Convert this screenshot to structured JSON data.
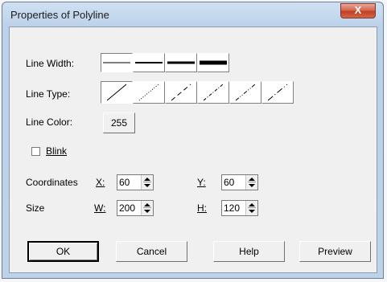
{
  "window": {
    "title": "Properties of Polyline",
    "close_glyph": "X"
  },
  "line_width": {
    "label": "Line Width:",
    "options": [
      "1",
      "2",
      "3",
      "4"
    ],
    "selected_index": 0
  },
  "line_type": {
    "label": "Line Type:",
    "options": [
      "solid",
      "dot",
      "dash",
      "dash-dot",
      "dash-dot-dot",
      "long-dash"
    ],
    "selected_index": 0
  },
  "line_color": {
    "label": "Line Color:",
    "value": "255"
  },
  "blink": {
    "label": "Blink",
    "checked": false
  },
  "coordinates": {
    "label": "Coordinates",
    "x_label": "X:",
    "x_value": "60",
    "y_label": "Y:",
    "y_value": "60"
  },
  "size": {
    "label": "Size",
    "w_label": "W:",
    "w_value": "200",
    "h_label": "H:",
    "h_value": "120"
  },
  "buttons": {
    "ok": "OK",
    "cancel": "Cancel",
    "help": "Help",
    "preview": "Preview"
  },
  "colors": {
    "close_button": "#c13f22",
    "dialog_face": "#f0f0f0",
    "frame": "#bcd2ea"
  }
}
